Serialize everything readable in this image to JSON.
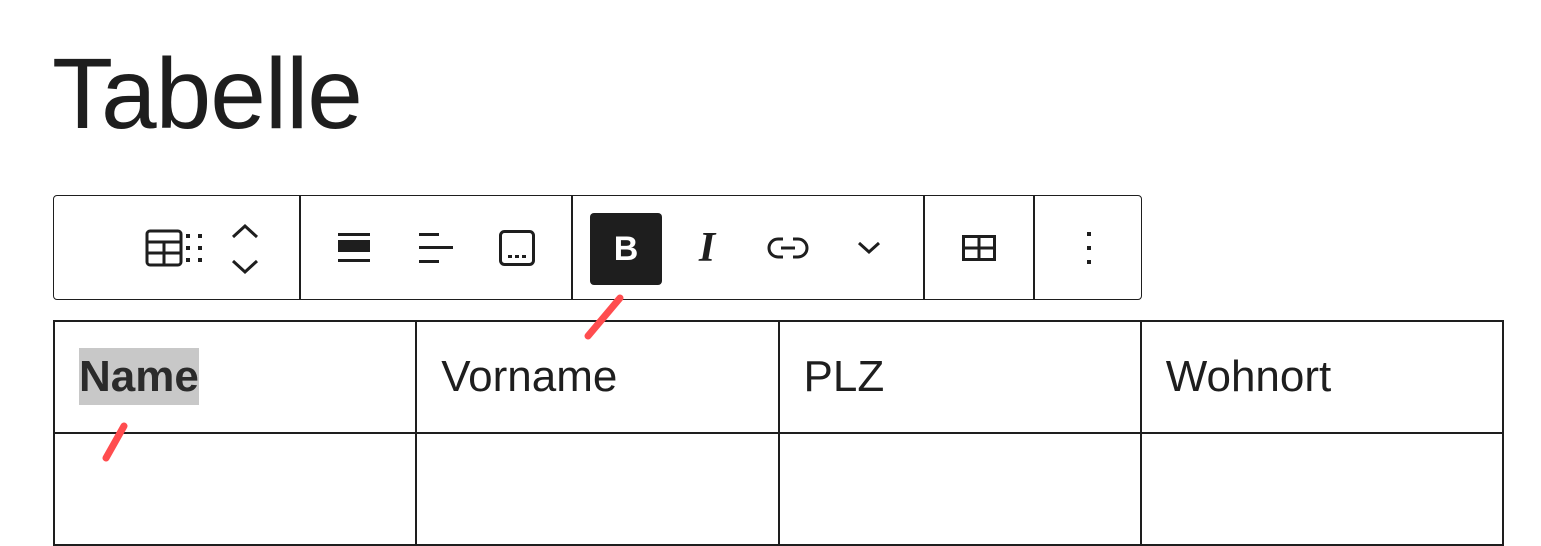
{
  "page": {
    "title": "Tabelle"
  },
  "toolbar": {
    "groups": [
      {
        "name": "block-controls",
        "items": [
          "table-block-icon",
          "drag-handle-icon",
          "move-up-icon",
          "move-down-icon"
        ]
      },
      {
        "name": "alignment-controls",
        "items": [
          "header-section-icon",
          "align-text-icon",
          "caption-icon"
        ]
      },
      {
        "name": "format-controls",
        "items": [
          "bold-icon",
          "italic-icon",
          "link-icon",
          "more-formats-chevron-icon"
        ]
      },
      {
        "name": "table-edit-controls",
        "items": [
          "edit-table-icon"
        ]
      },
      {
        "name": "options",
        "items": [
          "options-more-icon"
        ]
      }
    ],
    "bold_label": "B",
    "italic_label": "I",
    "bold_pressed": true
  },
  "table": {
    "rows": [
      [
        "Name",
        "Vorname",
        "PLZ",
        "Wohnort"
      ],
      [
        "",
        "",
        "",
        ""
      ]
    ],
    "selected_cell_text": "Name"
  },
  "colors": {
    "text": "#1e1e1e",
    "pressed_button_bg": "#1e1e1e",
    "selection_highlight": "#c8c8c8",
    "annotation_arrow": "#ff4d4f"
  }
}
